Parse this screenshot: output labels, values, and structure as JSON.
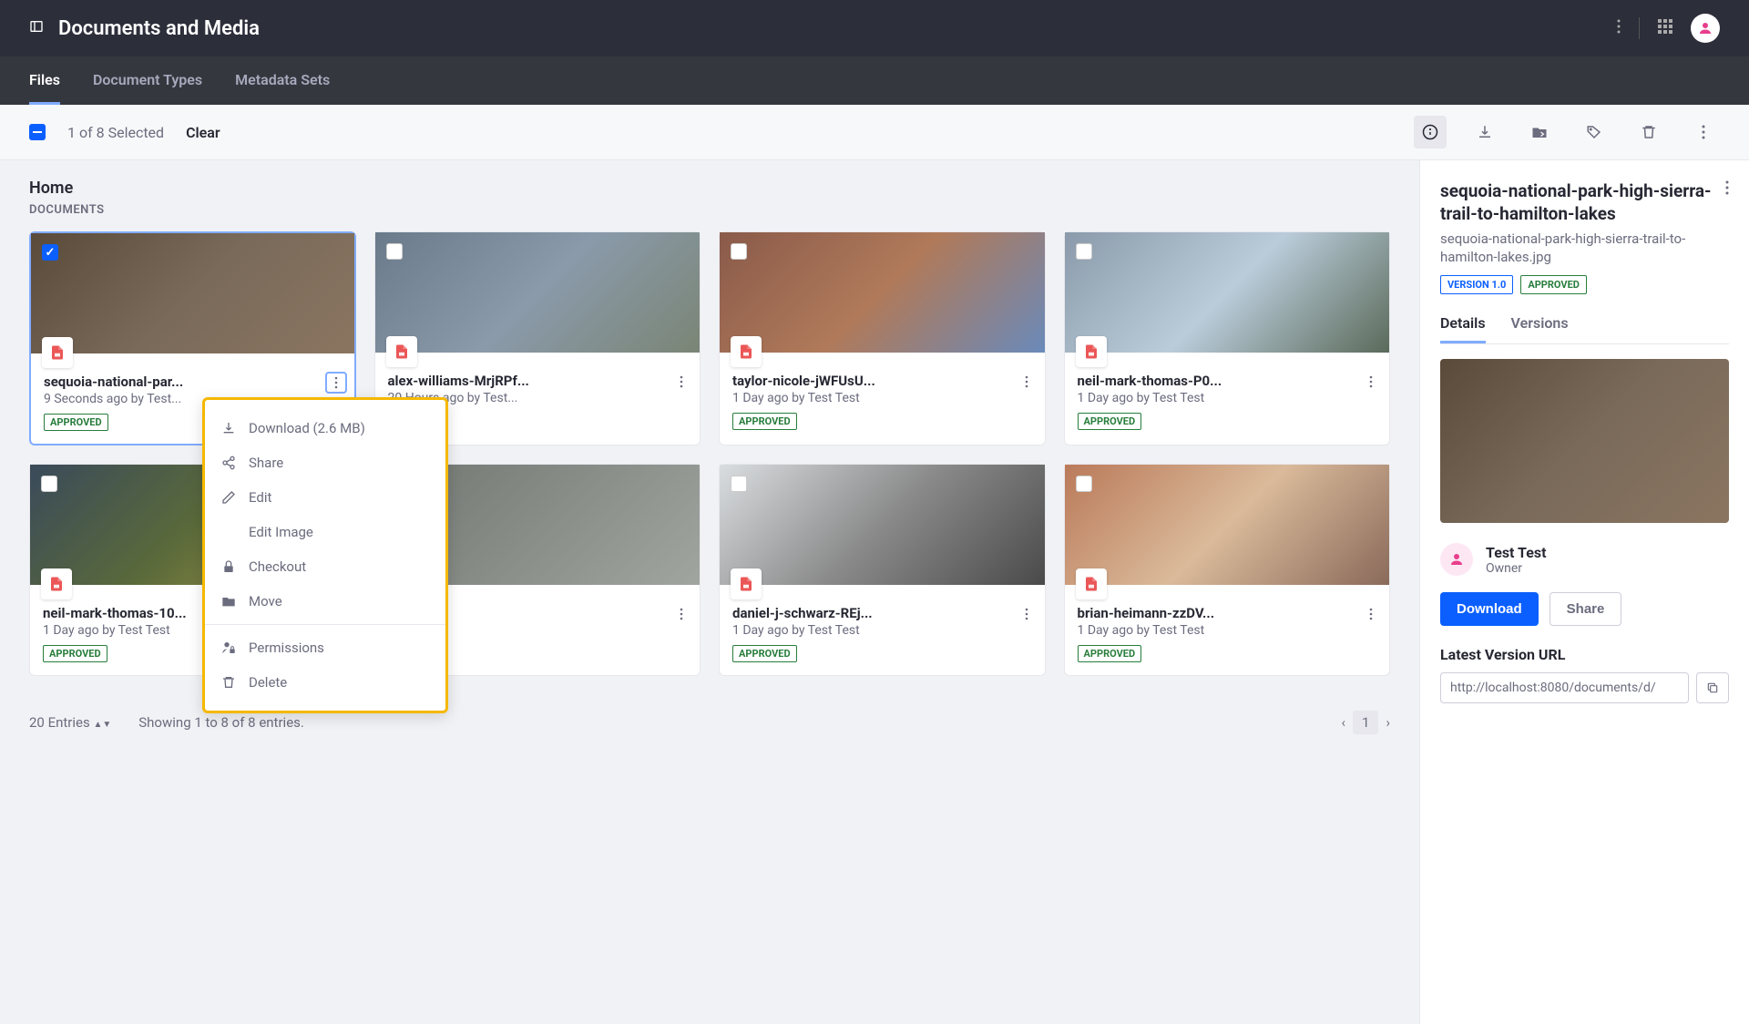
{
  "header": {
    "title": "Documents and Media"
  },
  "tabs": {
    "files": "Files",
    "docTypes": "Document Types",
    "metadata": "Metadata Sets"
  },
  "toolbar": {
    "selected": "1 of 8 Selected",
    "clear": "Clear"
  },
  "main": {
    "breadcrumb": "Home",
    "section": "DOCUMENTS"
  },
  "cards": [
    {
      "title": "sequoia-national-par...",
      "meta": "9 Seconds ago by Test...",
      "status": "APPROVED",
      "selected": true,
      "moreActive": true,
      "bg": "img-bg1"
    },
    {
      "title": "alex-williams-MrjRPf...",
      "meta": "20 Hours ago by Test...",
      "status": "",
      "selected": false,
      "moreActive": false,
      "bg": "img-bg2"
    },
    {
      "title": "taylor-nicole-jWFUsU...",
      "meta": "1 Day ago by Test Test",
      "status": "APPROVED",
      "selected": false,
      "moreActive": false,
      "bg": "img-bg3"
    },
    {
      "title": "neil-mark-thomas-P0...",
      "meta": "1 Day ago by Test Test",
      "status": "APPROVED",
      "selected": false,
      "moreActive": false,
      "bg": "img-bg4"
    },
    {
      "title": "neil-mark-thomas-10...",
      "meta": "1 Day ago by Test Test",
      "status": "APPROVED",
      "selected": false,
      "moreActive": false,
      "bg": "img-bg5"
    },
    {
      "title": "",
      "meta": "",
      "status": "",
      "selected": false,
      "moreActive": false,
      "bg": "img-bg6"
    },
    {
      "title": "daniel-j-schwarz-REj...",
      "meta": "1 Day ago by Test Test",
      "status": "APPROVED",
      "selected": false,
      "moreActive": false,
      "bg": "img-bg7"
    },
    {
      "title": "brian-heimann-zzDV...",
      "meta": "1 Day ago by Test Test",
      "status": "APPROVED",
      "selected": false,
      "moreActive": false,
      "bg": "img-bg8"
    }
  ],
  "dropdown": {
    "download": "Download (2.6 MB)",
    "share": "Share",
    "edit": "Edit",
    "editImage": "Edit Image",
    "checkout": "Checkout",
    "move": "Move",
    "permissions": "Permissions",
    "delete": "Delete"
  },
  "pagination": {
    "entries": "20 Entries",
    "showing": "Showing 1 to 8 of 8 entries.",
    "page": "1"
  },
  "panel": {
    "title": "sequoia-national-park-high-sierra-trail-to-hamilton-lakes",
    "subtitle": "sequoia-national-park-high-sierra-trail-to-hamilton-lakes.jpg",
    "version": "VERSION 1.0",
    "approved": "APPROVED",
    "tabDetails": "Details",
    "tabVersions": "Versions",
    "ownerName": "Test Test",
    "ownerRole": "Owner",
    "download": "Download",
    "share": "Share",
    "urlLabel": "Latest Version URL",
    "url": "http://localhost:8080/documents/d/"
  }
}
